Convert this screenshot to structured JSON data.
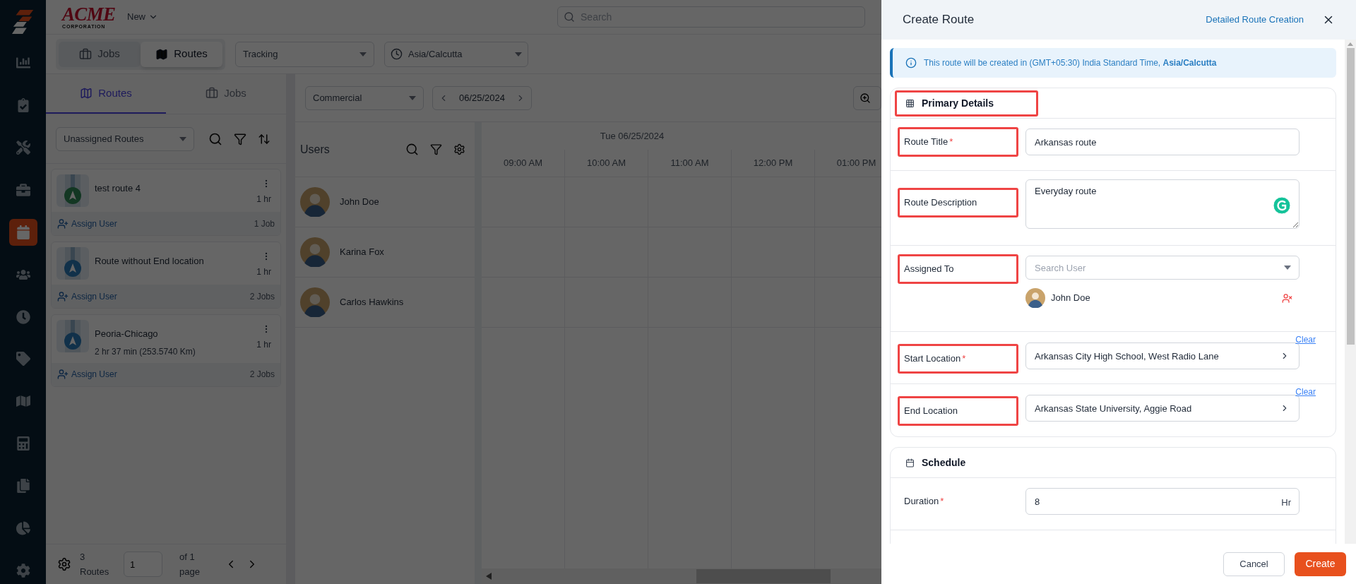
{
  "sidebar": {
    "items": [
      {
        "selected": false
      },
      {
        "selected": false
      },
      {
        "selected": false
      },
      {
        "selected": false
      },
      {
        "selected": true
      },
      {
        "selected": false
      },
      {
        "selected": false
      },
      {
        "selected": false
      },
      {
        "selected": false
      },
      {
        "selected": false
      },
      {
        "selected": false
      },
      {
        "selected": false
      },
      {
        "selected": false
      }
    ]
  },
  "header": {
    "logo_name": "ACME",
    "logo_tagline": "CORPORATION",
    "new_menu": "New",
    "search": {
      "placeholder": "Search"
    }
  },
  "view_switch": [
    {
      "label": "Jobs",
      "selected": false
    },
    {
      "label": "Routes",
      "selected": true
    }
  ],
  "tracking_select": "Tracking",
  "timezone_select": "Asia/Calcutta",
  "left_panel": {
    "tabs": [
      {
        "label": "Routes",
        "selected": true
      },
      {
        "label": "Jobs",
        "selected": false
      }
    ],
    "filter_select": "Unassigned Routes",
    "routes": [
      {
        "title": "test route 4",
        "duration": "1 hr",
        "assign": "Assign User",
        "jobs": "1 Job",
        "color": "#133723"
      },
      {
        "title": "Route without End location",
        "duration": "1 hr",
        "assign": "Assign User",
        "jobs": "2 Jobs",
        "color": "#11314a"
      },
      {
        "title": "Peoria-Chicago",
        "detail": "2 hr 37 min (253.5740 Km)",
        "duration": "1 hr",
        "assign": "Assign User",
        "jobs": "2 Jobs",
        "color": "#11314a"
      }
    ],
    "footer": {
      "count": "3 Routes",
      "page": "1",
      "of_pages": "of 1 page"
    }
  },
  "scheduler": {
    "category_select": "Commercial",
    "date": "06/25/2024",
    "users_title": "Users",
    "day_label": "Tue 06/25/2024",
    "hours": [
      "09:00 AM",
      "10:00 AM",
      "11:00 AM",
      "12:00 PM",
      "01:00 PM"
    ],
    "users": [
      {
        "name": "John Doe"
      },
      {
        "name": "Karina Fox"
      },
      {
        "name": "Carlos Hawkins"
      }
    ]
  },
  "create_route": {
    "title": "Create Route",
    "detail_link": "Detailed Route Creation",
    "notice": "This route will be created in (GMT+05:30) India Standard Time, **Asia/Calcutta**",
    "required_mark": "*",
    "sections": [
      {
        "title": "Primary Details",
        "highlighted": true,
        "fields": [
          {
            "kind": "text",
            "label": "Route Title",
            "required": true,
            "highlighted": true,
            "value": "Arkansas route"
          },
          {
            "kind": "textarea",
            "label": "Route Description",
            "required": false,
            "highlighted": true,
            "value": "Everyday route"
          },
          {
            "kind": "user_select",
            "label": "Assigned To",
            "required": false,
            "highlighted": true,
            "placeholder": "Search User",
            "assigned_user": "John Doe"
          },
          {
            "kind": "location",
            "label": "Start Location",
            "required": true,
            "highlighted": true,
            "clear": "Clear",
            "value": "Arkansas City High School, West Radio Lane"
          },
          {
            "kind": "location",
            "label": "End Location",
            "required": false,
            "highlighted": true,
            "clear": "Clear",
            "value": "Arkansas State University, Aggie Road"
          }
        ]
      },
      {
        "title": "Schedule",
        "highlighted": false,
        "fields": [
          {
            "kind": "number",
            "label": "Duration",
            "required": true,
            "highlighted": false,
            "value": "8",
            "unit": "Hr"
          }
        ]
      }
    ],
    "cancel": "Cancel",
    "create": "Create"
  }
}
